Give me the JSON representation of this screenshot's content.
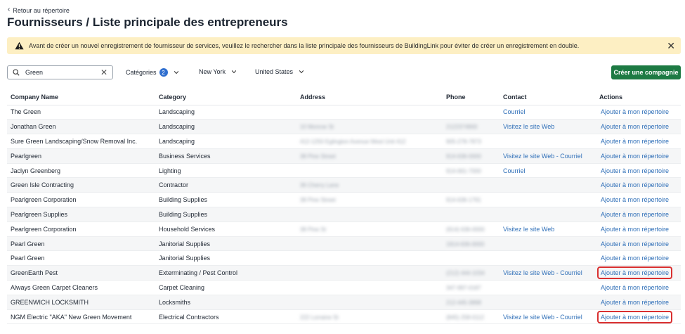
{
  "nav": {
    "back_label": "Retour au répertoire"
  },
  "page": {
    "title": "Fournisseurs / Liste principale des entrepreneurs"
  },
  "warning": {
    "text": "Avant de créer un nouvel enregistrement de fournisseur de services, veuillez le rechercher dans la liste principale des fournisseurs de BuildingLink pour éviter de créer un enregistrement en double.",
    "close_label": "✕"
  },
  "filters": {
    "search_value": "Green",
    "categories_label": "Catégories",
    "categories_count": "2",
    "state_label": "New York",
    "country_label": "United States"
  },
  "actions": {
    "create_label": "Créer une compagnie"
  },
  "table": {
    "headers": {
      "company": "Company Name",
      "category": "Category",
      "address": "Address",
      "phone": "Phone",
      "contact": "Contact",
      "actions": "Actions"
    },
    "rows": [
      {
        "company": "The Green",
        "category": "Landscaping",
        "address": "",
        "phone": "",
        "contact": "Courriel",
        "action": "Ajouter à mon répertoire"
      },
      {
        "company": "Jonathan Green",
        "category": "Landscaping",
        "address": "10 Monroe St",
        "phone": "2122374900",
        "contact": "Visitez le site Web",
        "action": "Ajouter à mon répertoire"
      },
      {
        "company": "Sure Green Landscaping/Snow Removal Inc.",
        "category": "Landscaping",
        "address": "412-1250 Eglington Avenue West Unit 412",
        "phone": "905-278-7873",
        "contact": "",
        "action": "Ajouter à mon répertoire"
      },
      {
        "company": "Pearlgreen",
        "category": "Business Services",
        "address": "38 Pine Street",
        "phone": "914-636-0000",
        "contact": "Visitez le site Web - Courriel",
        "action": "Ajouter à mon répertoire"
      },
      {
        "company": "Jaclyn Greenberg",
        "category": "Lighting",
        "address": "",
        "phone": "914-661-7000",
        "contact": "Courriel",
        "action": "Ajouter à mon répertoire"
      },
      {
        "company": "Green Isle Contracting",
        "category": "Contractor",
        "address": "36 Cherry Lane",
        "phone": "",
        "contact": "",
        "action": "Ajouter à mon répertoire"
      },
      {
        "company": "Pearlgreen Corporation",
        "category": "Building Supplies",
        "address": "38 Pine Street",
        "phone": "914-636-1791",
        "contact": "",
        "action": "Ajouter à mon répertoire"
      },
      {
        "company": "Pearlgreen Supplies",
        "category": "Building Supplies",
        "address": "",
        "phone": "",
        "contact": "",
        "action": "Ajouter à mon répertoire"
      },
      {
        "company": "Pearlgreen Corporation",
        "category": "Household Services",
        "address": "38 Pine St",
        "phone": "(914) 636-0000",
        "contact": "Visitez le site Web",
        "action": "Ajouter à mon répertoire"
      },
      {
        "company": "Pearl Green",
        "category": "Janitorial Supplies",
        "address": "",
        "phone": "1914-636-0000",
        "contact": "",
        "action": "Ajouter à mon répertoire"
      },
      {
        "company": "Pearl Green",
        "category": "Janitorial Supplies",
        "address": "",
        "phone": "",
        "contact": "",
        "action": "Ajouter à mon répertoire"
      },
      {
        "company": "GreenEarth Pest",
        "category": "Exterminating / Pest Control",
        "address": "",
        "phone": "(212) 444-1034",
        "contact": "Visitez le site Web - Courriel",
        "action": "Ajouter à mon répertoire",
        "highlight": true
      },
      {
        "company": "Always Green Carpet Cleaners",
        "category": "Carpet Cleaning",
        "address": "",
        "phone": "347-997-0187",
        "contact": "",
        "action": "Ajouter à mon répertoire"
      },
      {
        "company": "GREENWICH LOCKSMITH",
        "category": "Locksmiths",
        "address": "",
        "phone": "212-445-3898",
        "contact": "",
        "action": "Ajouter à mon répertoire"
      },
      {
        "company": "NGM Electric \"AKA\" New Green Movement",
        "category": "Electrical Contractors",
        "address": "222 Lorraine St",
        "phone": "(845) 258-0112",
        "contact": "Visitez le site Web - Courriel",
        "action": "Ajouter à mon répertoire",
        "highlight": true
      }
    ]
  },
  "colors": {
    "accent": "#2f6fb8",
    "create_button": "#1d7a43",
    "warning_bg": "#fdefc3",
    "highlight_border": "#d93030"
  }
}
